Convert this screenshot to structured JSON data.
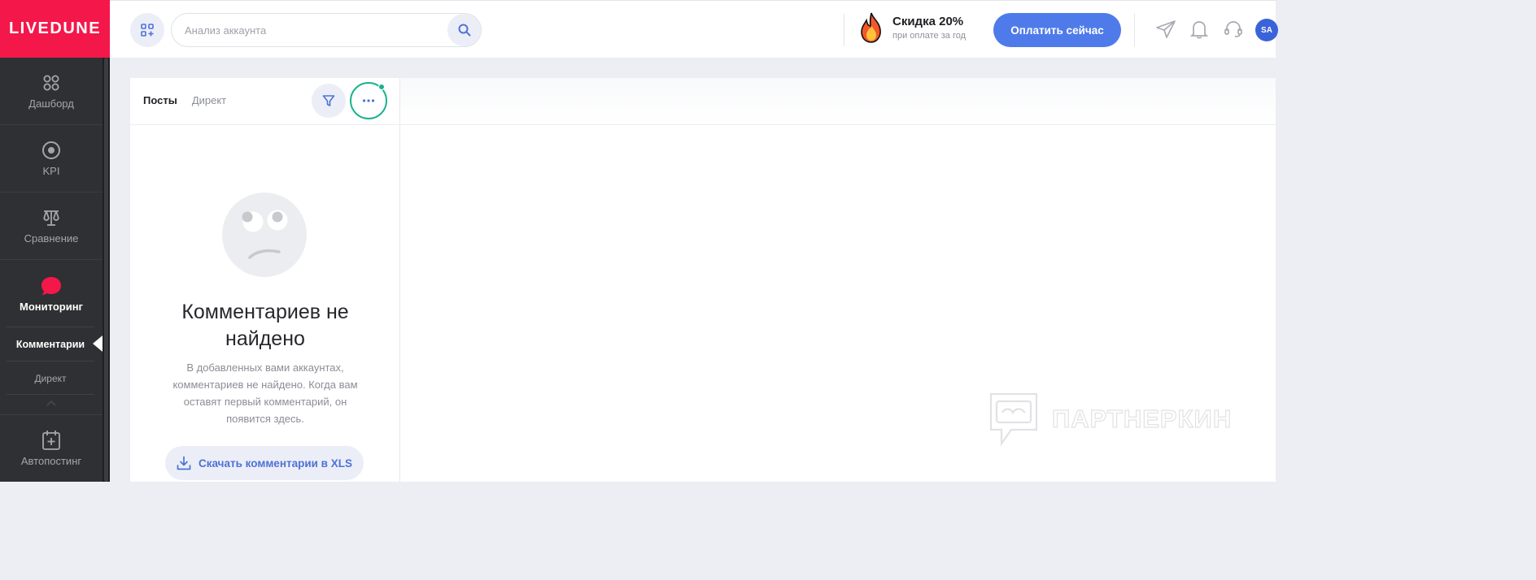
{
  "app": {
    "logo_text": "LIVEDUNE"
  },
  "sidebar": {
    "items": [
      {
        "label": "Дашборд",
        "icon": "dashboard-icon"
      },
      {
        "label": "KPI",
        "icon": "target-icon"
      },
      {
        "label": "Сравнение",
        "icon": "scales-icon"
      },
      {
        "label": "Мониторинг",
        "icon": "chat-bubble-icon",
        "active": true
      },
      {
        "label": "Автопостинг",
        "icon": "calendar-plus-icon"
      }
    ],
    "subitems": [
      {
        "label": "Комментарии",
        "active": true
      },
      {
        "label": "Директ",
        "active": false
      }
    ]
  },
  "header": {
    "search": {
      "placeholder": "Анализ аккаунта"
    },
    "promo": {
      "title": "Скидка 20%",
      "subtitle": "при оплате за год"
    },
    "pay_button": "Оплатить сейчас",
    "avatar": "SA"
  },
  "panel": {
    "tabs": [
      {
        "label": "Посты",
        "active": true
      },
      {
        "label": "Директ",
        "active": false
      }
    ],
    "empty": {
      "title": "Комментариев не найдено",
      "text": "В добавленных вами аккаунтах, комментариев не найдено. Когда вам оставят первый комментарий, он появится здесь."
    },
    "download_button": "Скачать комментарии в XLS"
  },
  "colors": {
    "brand": "#f4174a",
    "accent": "#4f7bea",
    "highlight": "#17b28c",
    "sidebar": "#2f3033"
  },
  "watermark": {
    "text": "ПАРТНЕРКИН"
  }
}
